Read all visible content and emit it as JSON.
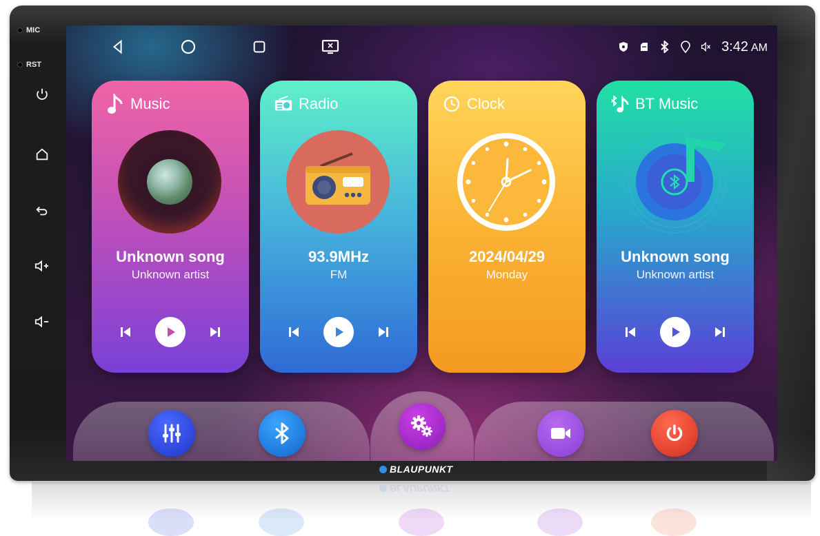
{
  "device": {
    "side_labels": {
      "mic": "MIC",
      "rst": "RST"
    },
    "side_buttons": [
      "power-icon",
      "home-icon",
      "back-icon",
      "volume-up-icon",
      "volume-down-icon"
    ],
    "brand": "BLAUPUNKT"
  },
  "statusbar": {
    "nav": [
      "back-triangle-icon",
      "home-circle-icon",
      "recents-square-icon",
      "screen-mirror-icon"
    ],
    "indicators": [
      "shield-icon",
      "sd-card-icon",
      "bluetooth-icon",
      "location-icon",
      "mute-icon"
    ],
    "time": "3:42",
    "ampm": "AM"
  },
  "cards": {
    "music": {
      "title": "Music",
      "icon": "music-note-icon",
      "song": "Unknown song",
      "artist": "Unknown artist",
      "color_top": "#f064a6",
      "color_bottom": "#7a40d8"
    },
    "radio": {
      "title": "Radio",
      "icon": "radio-icon",
      "frequency": "93.9MHz",
      "band": "FM",
      "color_top": "#5ff0c8",
      "color_bottom": "#2f6ad6"
    },
    "clock": {
      "title": "Clock",
      "icon": "clock-icon",
      "date": "2024/04/29",
      "weekday": "Monday",
      "color_top": "#ffd55a",
      "color_bottom": "#f39a22"
    },
    "bt_music": {
      "title": "BT Music",
      "icon": "bluetooth-music-icon",
      "song": "Unknown song",
      "artist": "Unknown artist",
      "color_top": "#21e0a3",
      "color_bottom": "#5a3fd6"
    }
  },
  "dock": [
    {
      "name": "equalizer",
      "icon": "equalizer-icon",
      "color": "#2f44d8"
    },
    {
      "name": "bluetooth",
      "icon": "bluetooth-icon",
      "color": "#1f7fe0"
    },
    {
      "name": "settings",
      "icon": "settings-gears-icon",
      "color": "#a52cd0"
    },
    {
      "name": "camera",
      "icon": "video-camera-icon",
      "color": "#9a3fd8"
    },
    {
      "name": "power",
      "icon": "power-icon",
      "color": "#e8402e"
    }
  ]
}
